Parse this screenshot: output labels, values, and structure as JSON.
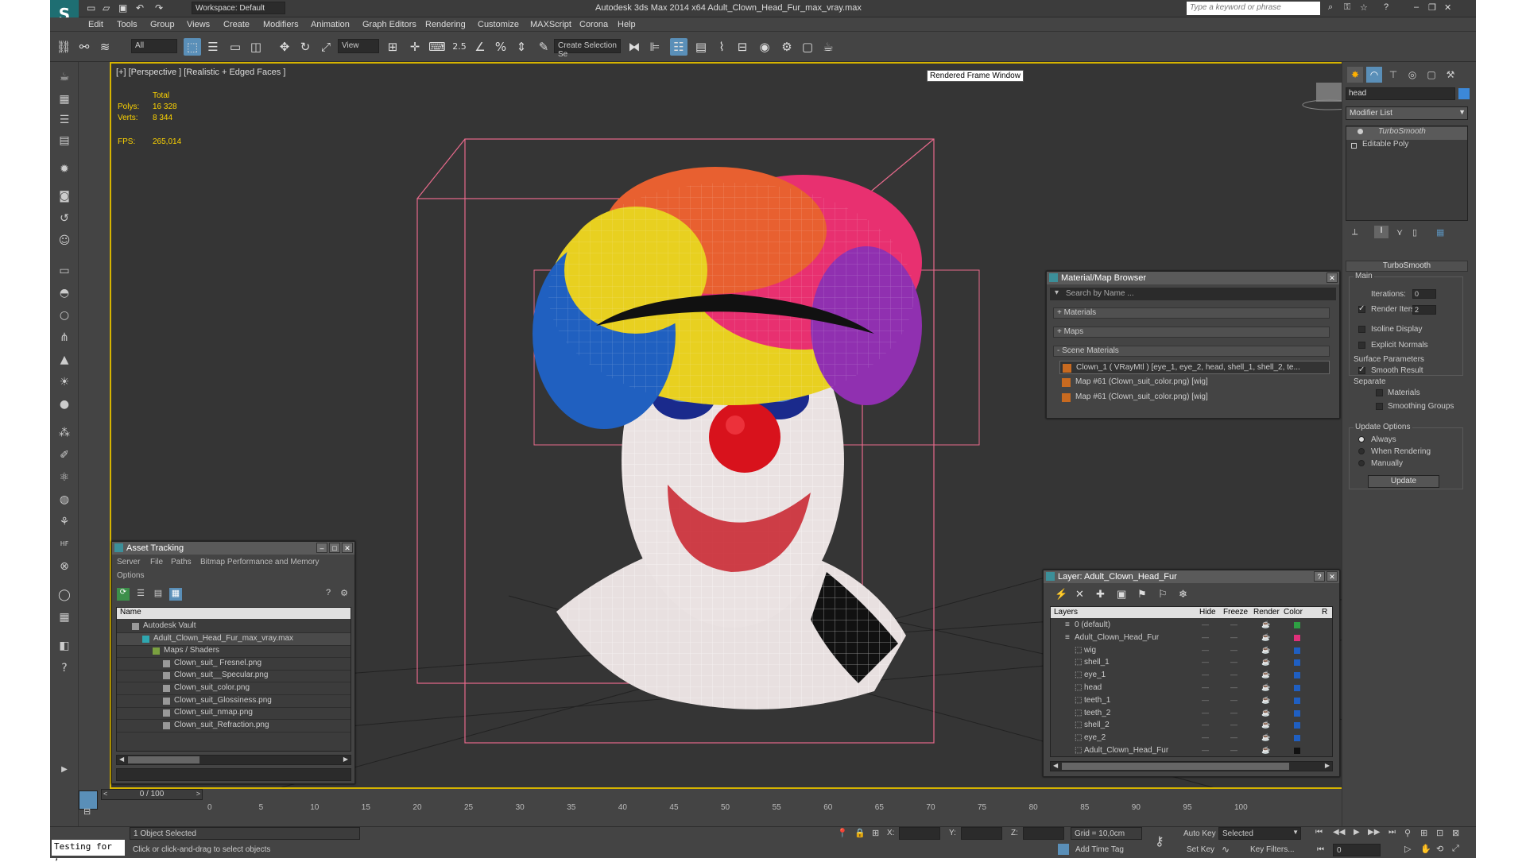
{
  "window": {
    "title": "Autodesk 3ds Max  2014 x64     Adult_Clown_Head_Fur_max_vray.max",
    "workspace": "Workspace: Default",
    "search_placeholder": "Type a keyword or phrase"
  },
  "menu": [
    "Edit",
    "Tools",
    "Group",
    "Views",
    "Create",
    "Modifiers",
    "Animation",
    "Graph Editors",
    "Rendering",
    "Customize",
    "MAXScript",
    "Corona",
    "Help"
  ],
  "toolbar": {
    "filter": "All",
    "ref_coord": "View",
    "selection_set": "Create Selection Se",
    "snap_label": "2.5"
  },
  "viewport": {
    "label": "[+] [Perspective ] [Realistic + Edged Faces ]",
    "stats_total_label": "Total",
    "polys_label": "Polys:",
    "polys_value": "16 328",
    "verts_label": "Verts:",
    "verts_value": "8 344",
    "fps_label": "FPS:",
    "fps_value": "265,014",
    "tooltip": "Rendered Frame Window"
  },
  "material_browser": {
    "title": "Material/Map Browser",
    "search_placeholder": "Search by Name ...",
    "groups": [
      "+ Materials",
      "+ Maps",
      "- Scene Materials"
    ],
    "items": [
      "Clown_1  ( VRayMtl ) [eye_1, eye_2, head, shell_1, shell_2, te...",
      "Map #61 (Clown_suit_color.png) [wig]",
      "Map #61 (Clown_suit_color.png) [wig]"
    ]
  },
  "asset_tracking": {
    "title": "Asset Tracking",
    "menu": [
      "Server",
      "File",
      "Paths",
      "Bitmap Performance and Memory"
    ],
    "menu2": "Options",
    "column": "Name",
    "rows": [
      {
        "label": "Autodesk Vault",
        "indent": 1
      },
      {
        "label": "Adult_Clown_Head_Fur_max_vray.max",
        "indent": 2
      },
      {
        "label": "Maps / Shaders",
        "indent": 3
      },
      {
        "label": "Clown_suit_ Fresnel.png",
        "indent": 4
      },
      {
        "label": "Clown_suit__Specular.png",
        "indent": 4
      },
      {
        "label": "Clown_suit_color.png",
        "indent": 4
      },
      {
        "label": "Clown_suit_Glossiness.png",
        "indent": 4
      },
      {
        "label": "Clown_suit_nmap.png",
        "indent": 4
      },
      {
        "label": "Clown_suit_Refraction.png",
        "indent": 4
      }
    ]
  },
  "layer_panel": {
    "title": "Layer: Adult_Clown_Head_Fur",
    "columns": [
      "Layers",
      "Hide",
      "Freeze",
      "Render",
      "Color",
      "R"
    ],
    "rows": [
      {
        "name": "0 (default)",
        "indent": 1,
        "color": "#2ea043"
      },
      {
        "name": "Adult_Clown_Head_Fur",
        "indent": 1,
        "color": "#e0307a"
      },
      {
        "name": "wig",
        "indent": 2,
        "color": "#1f5fc2"
      },
      {
        "name": "shell_1",
        "indent": 2,
        "color": "#1f5fc2"
      },
      {
        "name": "eye_1",
        "indent": 2,
        "color": "#1f5fc2"
      },
      {
        "name": "head",
        "indent": 2,
        "color": "#1f5fc2"
      },
      {
        "name": "teeth_1",
        "indent": 2,
        "color": "#1f5fc2"
      },
      {
        "name": "teeth_2",
        "indent": 2,
        "color": "#1f5fc2"
      },
      {
        "name": "shell_2",
        "indent": 2,
        "color": "#1f5fc2"
      },
      {
        "name": "eye_2",
        "indent": 2,
        "color": "#1f5fc2"
      },
      {
        "name": "Adult_Clown_Head_Fur",
        "indent": 2,
        "color": "#111111"
      }
    ]
  },
  "command_panel": {
    "object_name": "head",
    "modifier_list": "Modifier List",
    "stack": [
      "TurboSmooth",
      "Editable Poly"
    ],
    "rollout_title": "TurboSmooth",
    "main": "Main",
    "iterations_label": "Iterations:",
    "iterations_value": "0",
    "render_iters_label": "Render Iters:",
    "render_iters_value": "2",
    "isoline": "Isoline Display",
    "explicit_normals": "Explicit Normals",
    "surface_params": "Surface Parameters",
    "smooth_result": "Smooth Result",
    "separate": "Separate",
    "materials": "Materials",
    "smoothing_groups": "Smoothing Groups",
    "update_options": "Update Options",
    "always": "Always",
    "when_rendering": "When Rendering",
    "manually": "Manually",
    "update_button": "Update"
  },
  "timeline": {
    "frame_label": "0 / 100",
    "ticks": [
      "0",
      "5",
      "10",
      "15",
      "20",
      "25",
      "30",
      "35",
      "40",
      "45",
      "50",
      "55",
      "60",
      "65",
      "70",
      "75",
      "80",
      "85",
      "90",
      "95",
      "100"
    ]
  },
  "status": {
    "script_listener": "Testing for ,",
    "selected": "1 Object Selected",
    "prompt": "Click or click-and-drag to select objects",
    "x_label": "X:",
    "y_label": "Y:",
    "z_label": "Z:",
    "grid": "Grid = 10,0cm",
    "add_time_tag": "Add Time Tag",
    "auto_key": "Auto Key",
    "set_key": "Set Key",
    "selected_dd": "Selected",
    "key_filters": "Key Filters...",
    "frame_field": "0"
  }
}
